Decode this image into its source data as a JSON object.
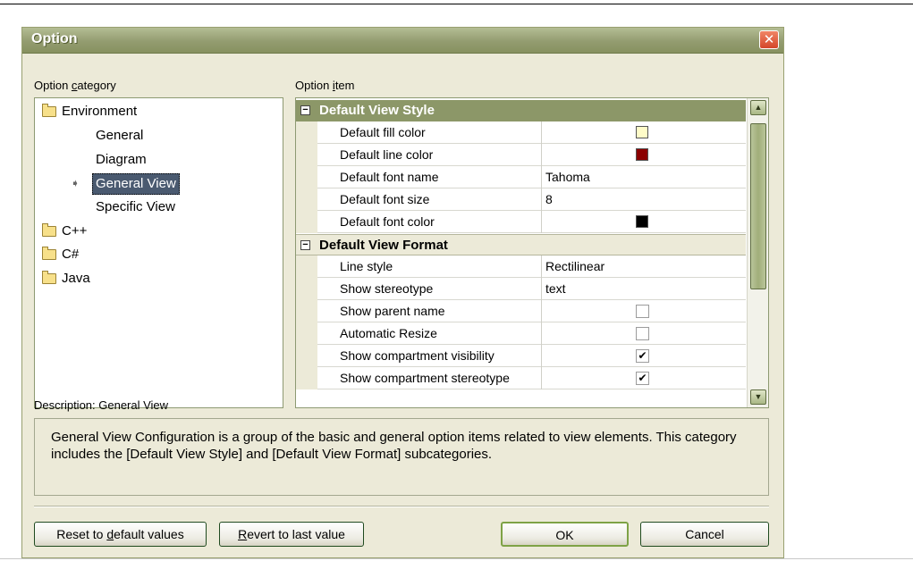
{
  "window": {
    "title": "Option",
    "close_glyph": "✕"
  },
  "category_panel": {
    "label_prefix": "Option ",
    "label_mnemonic": "c",
    "label_suffix": "ategory",
    "tree": [
      {
        "label": "Environment",
        "icon": "folder-icon",
        "children": [
          "General",
          "Diagram",
          "General View",
          "Specific View"
        ],
        "selected": "General View"
      },
      {
        "label": "C++",
        "icon": "folder-icon"
      },
      {
        "label": "C#",
        "icon": "folder-icon"
      },
      {
        "label": "Java",
        "icon": "folder-icon"
      }
    ],
    "selected_marker": "➧"
  },
  "item_panel": {
    "label_prefix": "Option ",
    "label_mnemonic": "i",
    "label_suffix": "tem",
    "sections": [
      {
        "title": "Default View Style",
        "toggle": "⊟",
        "rows": [
          {
            "name": "Default fill color",
            "type": "color",
            "color": "#fffcc8"
          },
          {
            "name": "Default line color",
            "type": "color",
            "color": "#8b0000"
          },
          {
            "name": "Default font name",
            "type": "text",
            "value": "Tahoma"
          },
          {
            "name": "Default font size",
            "type": "text",
            "value": "8"
          },
          {
            "name": "Default font color",
            "type": "color",
            "color": "#000000"
          }
        ]
      },
      {
        "title": "Default View Format",
        "toggle": "⊟",
        "rows": [
          {
            "name": "Line style",
            "type": "text",
            "value": "Rectilinear"
          },
          {
            "name": "Show stereotype",
            "type": "text",
            "value": "text"
          },
          {
            "name": "Show parent name",
            "type": "check",
            "checked": false
          },
          {
            "name": "Automatic Resize",
            "type": "check",
            "checked": false
          },
          {
            "name": "Show compartment visibility",
            "type": "check",
            "checked": true
          },
          {
            "name": "Show compartment stereotype",
            "type": "check",
            "checked": true
          }
        ]
      }
    ]
  },
  "description": {
    "label": "Description: General View",
    "text": "General View Configuration is a group of the basic and general option items related to view elements. This category includes the [Default View Style] and [Default View Format] subcategories."
  },
  "buttons": {
    "reset": {
      "before": "Reset to ",
      "mnemonic": "d",
      "after": "efault values"
    },
    "revert": {
      "before": "",
      "mnemonic": "R",
      "after": "evert to last value"
    },
    "ok": "OK",
    "cancel": "Cancel"
  },
  "colors": {
    "title_bar": "#939c70",
    "section_header": "#8c9768",
    "dialog_bg": "#ecead8",
    "selection": "#4a5a70"
  }
}
